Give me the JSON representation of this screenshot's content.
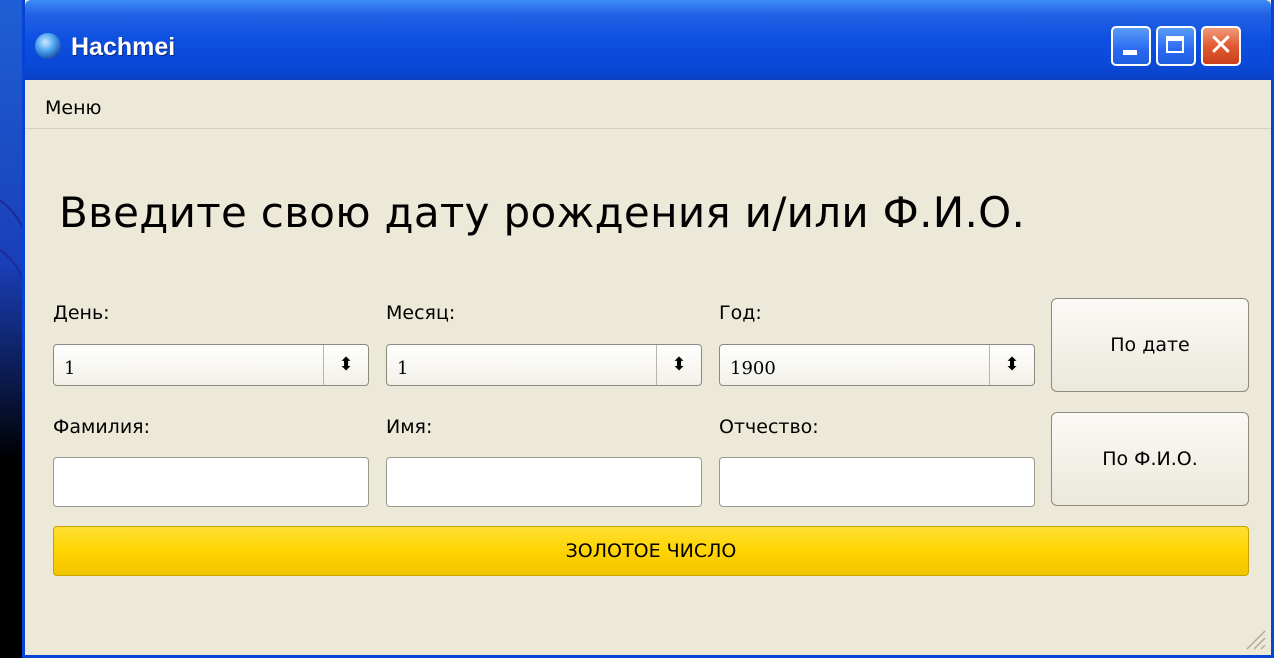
{
  "window": {
    "title": "Hachmei"
  },
  "menu": {
    "items": [
      "Меню"
    ]
  },
  "heading": "Введите свою дату рождения и/или Ф.И.О.",
  "date": {
    "day_label": "День:",
    "day_value": "1",
    "month_label": "Месяц:",
    "month_value": "1",
    "year_label": "Год:",
    "year_value": "1900"
  },
  "name": {
    "surname_label": "Фамилия:",
    "surname_value": "",
    "first_label": "Имя:",
    "first_value": "",
    "patronymic_label": "Отчество:",
    "patronymic_value": ""
  },
  "buttons": {
    "by_date": "По дате",
    "by_name": "По Ф.И.О.",
    "golden": "ЗОЛОТОЕ ЧИСЛО"
  },
  "icons": {
    "spin_arrows": "updown-arrows-icon",
    "close": "close-icon",
    "minimize": "minimize-icon",
    "maximize": "maximize-icon"
  },
  "colors": {
    "titlebar": "#0a48d6",
    "golden_button": "#ffd400",
    "window_bg": "#ece9d8"
  }
}
